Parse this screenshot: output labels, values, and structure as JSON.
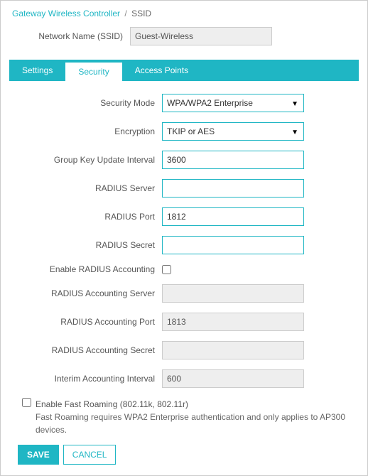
{
  "breadcrumb": {
    "parent": "Gateway Wireless Controller",
    "sep": "/",
    "current": "SSID"
  },
  "top": {
    "ssid_label": "Network Name (SSID)",
    "ssid_value": "Guest-Wireless"
  },
  "tabs": {
    "settings": "Settings",
    "security": "Security",
    "access_points": "Access Points"
  },
  "fields": {
    "security_mode_label": "Security Mode",
    "security_mode_value": "WPA/WPA2 Enterprise",
    "encryption_label": "Encryption",
    "encryption_value": "TKIP or AES",
    "group_key_label": "Group Key Update Interval",
    "group_key_value": "3600",
    "radius_server_label": "RADIUS Server",
    "radius_server_value": "",
    "radius_port_label": "RADIUS Port",
    "radius_port_value": "1812",
    "radius_secret_label": "RADIUS Secret",
    "radius_secret_value": "",
    "enable_radius_acct_label": "Enable RADIUS Accounting",
    "radius_acct_server_label": "RADIUS Accounting Server",
    "radius_acct_server_value": "",
    "radius_acct_port_label": "RADIUS Accounting Port",
    "radius_acct_port_value": "1813",
    "radius_acct_secret_label": "RADIUS Accounting Secret",
    "radius_acct_secret_value": "",
    "interim_interval_label": "Interim Accounting Interval",
    "interim_interval_value": "600"
  },
  "fast_roaming": {
    "label": "Enable Fast Roaming (802.11k, 802.11r)",
    "note": "Fast Roaming requires WPA2 Enterprise authentication and only applies to AP300 devices."
  },
  "buttons": {
    "save": "SAVE",
    "cancel": "CANCEL"
  }
}
